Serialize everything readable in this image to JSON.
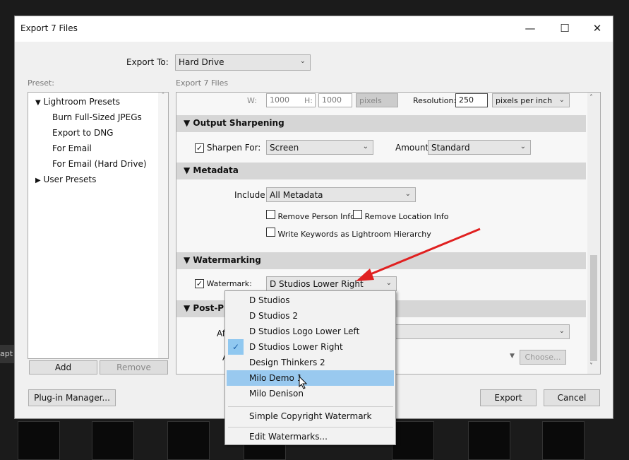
{
  "dialog": {
    "title": "Export 7 Files",
    "minimize": "—",
    "maximize": "☐",
    "close": "✕"
  },
  "export_to": {
    "label": "Export To:",
    "value": "Hard Drive"
  },
  "preset": {
    "label": "Preset:",
    "items": [
      {
        "label": "Lightroom Presets",
        "kind": "folder-open"
      },
      {
        "label": "Burn Full-Sized JPEGs",
        "kind": "item"
      },
      {
        "label": "Export to DNG",
        "kind": "item"
      },
      {
        "label": "For Email",
        "kind": "item"
      },
      {
        "label": "For Email (Hard Drive)",
        "kind": "item"
      },
      {
        "label": "User Presets",
        "kind": "folder-closed"
      }
    ],
    "add": "Add",
    "remove": "Remove"
  },
  "panel_label": "Export 7 Files",
  "sizing": {
    "w_label": "W:",
    "w": "1000",
    "h_label": "H:",
    "h": "1000",
    "unit": "pixels",
    "res_label": "Resolution:",
    "res": "250",
    "res_unit": "pixels per inch"
  },
  "sharpening": {
    "header": "Output Sharpening",
    "sharpen_label": "Sharpen For:",
    "sharpen_checked": true,
    "sharpen_value": "Screen",
    "amount_label": "Amount:",
    "amount_value": "Standard"
  },
  "metadata": {
    "header": "Metadata",
    "include_label": "Include:",
    "include_value": "All Metadata",
    "remove_person": "Remove Person Info",
    "remove_location": "Remove Location Info",
    "write_keywords": "Write Keywords as Lightroom Hierarchy"
  },
  "watermarking": {
    "header": "Watermarking",
    "label": "Watermark:",
    "checked": true,
    "value": "D Studios Lower Right"
  },
  "post": {
    "header": "Post-Pr",
    "after_label": "Af",
    "a_label": "A",
    "choose": "Choose..."
  },
  "menu": {
    "items": [
      "D Studios",
      "D Studios 2",
      "D Studios Logo Lower Left",
      "D Studios Lower Right",
      "Design Thinkers 2",
      "Milo Demo 1",
      "Milo Denison"
    ],
    "checked": "D Studios Lower Right",
    "hovered": "Milo Demo 1",
    "extra": "Simple Copyright Watermark",
    "edit": "Edit Watermarks..."
  },
  "footer": {
    "plugin": "Plug-in Manager...",
    "export": "Export",
    "cancel": "Cancel"
  },
  "background_text": "apt",
  "colors": {
    "hover": "#99c9ef",
    "arrow": "#e02020",
    "check_bg": "#90c8f0"
  }
}
